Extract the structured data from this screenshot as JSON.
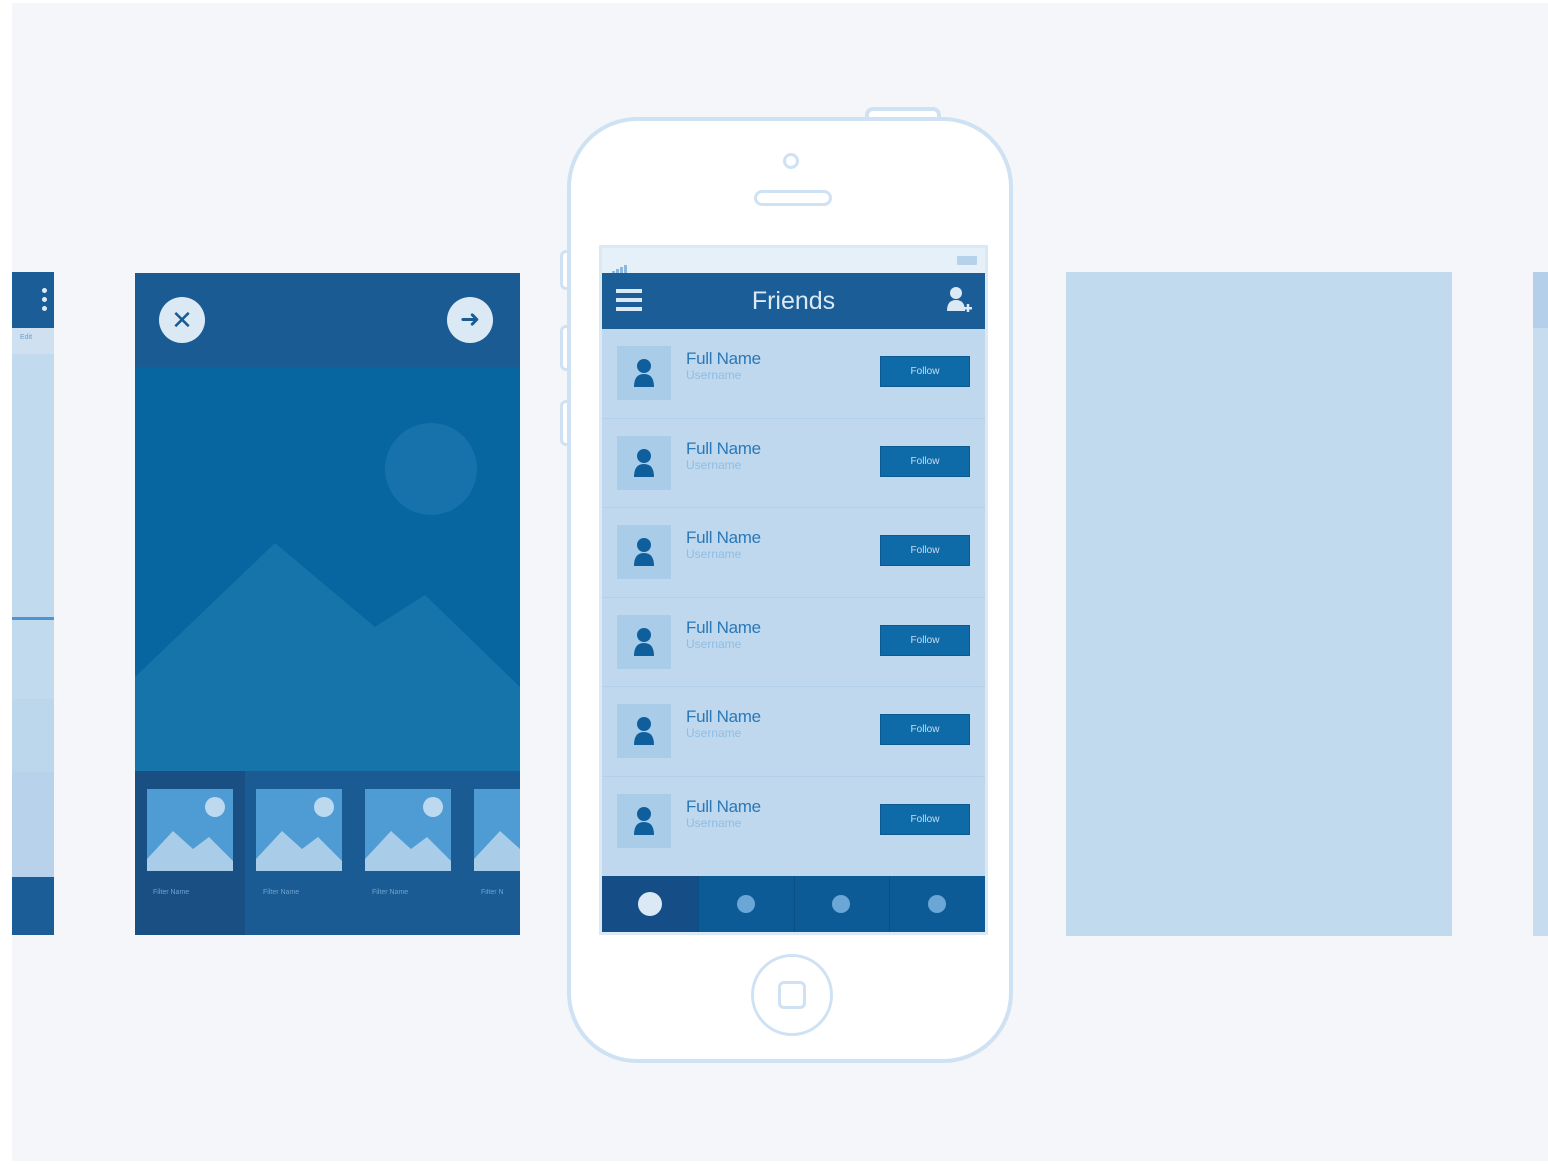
{
  "colors": {
    "background": "#f5f6f9",
    "navy": "#1b5d97",
    "screen_light": "#bfd8ee",
    "button_blue": "#0f6aa8",
    "phone_outline": "#cfe2f3"
  },
  "photo_screen": {
    "close_icon": "close-icon",
    "next_icon": "arrow-right-icon",
    "thumbnails": [
      {
        "label": "Filter Name"
      },
      {
        "label": "Filter Name"
      },
      {
        "label": "Filter Name"
      },
      {
        "label": "Filter N"
      }
    ]
  },
  "left_partial": {
    "strip_text": "Edit"
  },
  "phone": {
    "nav": {
      "title": "Friends",
      "menu_icon": "hamburger-icon",
      "action_icon": "add-user-icon"
    },
    "friends": [
      {
        "name": "Full Name",
        "username": "Username",
        "action": "Follow"
      },
      {
        "name": "Full Name",
        "username": "Username",
        "action": "Follow"
      },
      {
        "name": "Full Name",
        "username": "Username",
        "action": "Follow"
      },
      {
        "name": "Full Name",
        "username": "Username",
        "action": "Follow"
      },
      {
        "name": "Full Name",
        "username": "Username",
        "action": "Follow"
      },
      {
        "name": "Full Name",
        "username": "Username",
        "action": "Follow"
      }
    ],
    "tabbar": {
      "active_index": 0,
      "tabs": [
        "tab-1",
        "tab-2",
        "tab-3",
        "tab-4"
      ]
    }
  }
}
